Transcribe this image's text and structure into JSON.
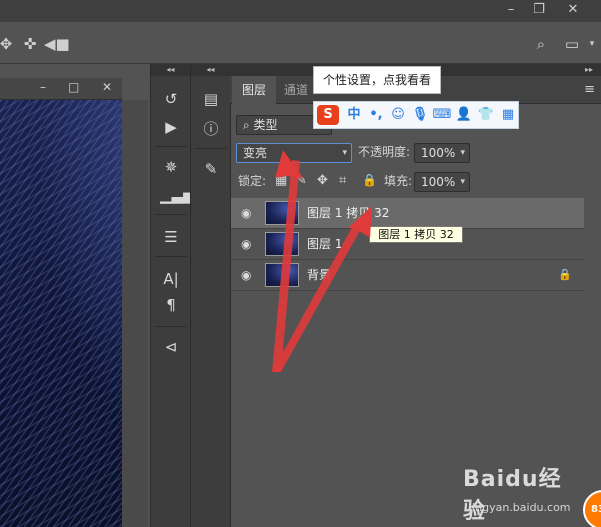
{
  "panels": {
    "tabs": [
      {
        "label": "图层",
        "active": true
      },
      {
        "label": "通道",
        "active": false
      }
    ],
    "filter_type": "类型",
    "blend_mode": "变亮",
    "opacity_label": "不透明度:",
    "opacity_value": "100%",
    "lock_label": "锁定:",
    "fill_label": "填充:",
    "fill_value": "100%"
  },
  "layers": [
    {
      "name": "图层 1 拷贝 32",
      "selected": true
    },
    {
      "name": "图层 1",
      "selected": false
    },
    {
      "name": "背景",
      "selected": false,
      "locked": true
    }
  ],
  "tooltip_text": "图层 1 拷贝 32",
  "ime": {
    "tip_text": "个性设置，点我看看",
    "mode_label": "中"
  },
  "watermark": {
    "brand": "Baidu经验",
    "url": "jingyan.baidu.com",
    "badge": "83"
  },
  "colors": {
    "arrow": "#e03a3a",
    "ime_accent": "#2a7de1",
    "badge": "#ff7a00"
  }
}
